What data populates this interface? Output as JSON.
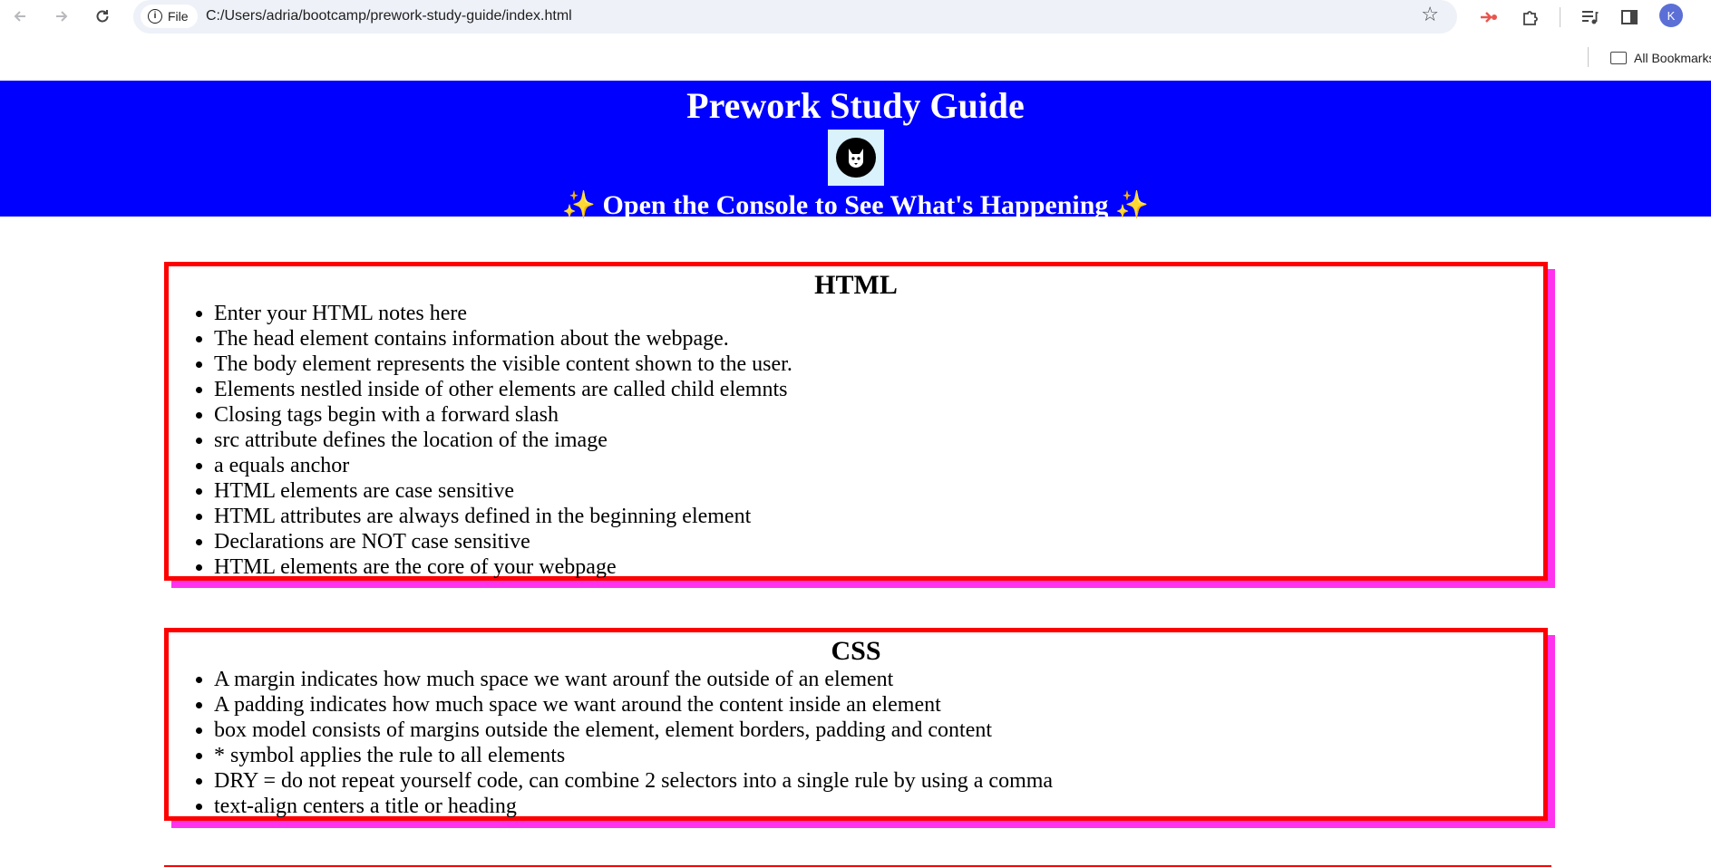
{
  "browser": {
    "site_chip": "File",
    "url": "C:/Users/adria/bootcamp/prework-study-guide/index.html",
    "profile_initial": "K",
    "bookmarks_label": "All Bookmarks",
    "icons": [
      "back-icon",
      "forward-icon",
      "reload-icon",
      "info-icon",
      "star-icon",
      "extension-icon",
      "puzzle-icon",
      "media-icon",
      "sidepanel-icon",
      "folder-icon"
    ]
  },
  "header": {
    "title": "Prework Study Guide",
    "subtitle": "✨ Open the Console to See What's Happening ✨",
    "colors": {
      "background": "#0000ff",
      "text": "#ffffff"
    }
  },
  "sections": [
    {
      "heading": "HTML",
      "items": [
        "Enter your HTML notes here",
        "The head element contains information about the webpage.",
        "The body element represents the visible content shown to the user.",
        "Elements nestled inside of other elements are called child elemnts",
        "Closing tags begin with a forward slash",
        "src attribute defines the location of the image",
        "a equals anchor",
        "HTML elements are case sensitive",
        "HTML attributes are always defined in the beginning element",
        "Declarations are NOT case sensitive",
        "HTML elements are the core of your webpage"
      ]
    },
    {
      "heading": "CSS",
      "items": [
        "A margin indicates how much space we want arounf the outside of an element",
        "A padding indicates how much space we want around the content inside an element",
        "box model consists of margins outside the element, element borders, padding and content",
        "* symbol applies the rule to all elements",
        "DRY = do not repeat yourself code, can combine 2 selectors into a single rule by using a comma",
        "text-align centers a title or heading"
      ]
    }
  ],
  "colors": {
    "card_border": "#ff0000",
    "card_shadow": "#ff33ee"
  }
}
